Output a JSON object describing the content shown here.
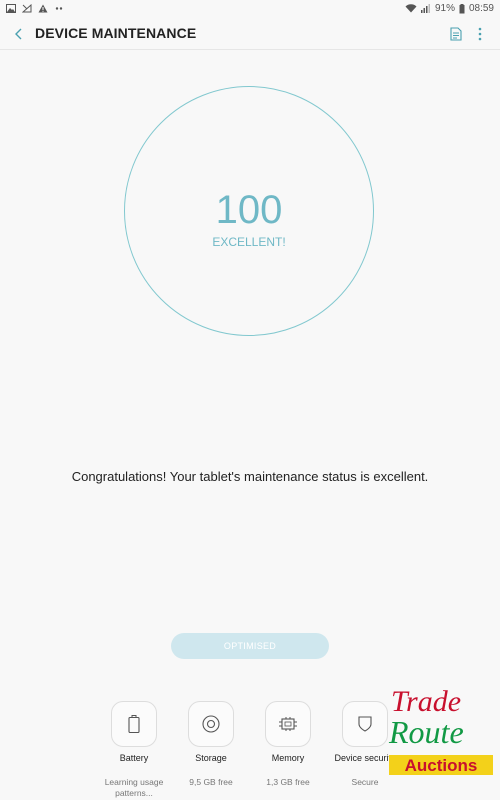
{
  "status_bar": {
    "battery": "91%",
    "time": "08:59"
  },
  "toolbar": {
    "title": "DEVICE MAINTENANCE"
  },
  "score": {
    "value": "100",
    "label": "EXCELLENT!"
  },
  "message": "Congratulations! Your tablet's maintenance status is excellent.",
  "optimise_button": {
    "label": "OPTIMISED",
    "enabled": false
  },
  "items": [
    {
      "label": "Battery",
      "value": "Learning usage patterns...",
      "icon": "battery-icon"
    },
    {
      "label": "Storage",
      "value": "9,5 GB free",
      "icon": "storage-icon"
    },
    {
      "label": "Memory",
      "value": "1,3 GB free",
      "icon": "memory-chip-icon"
    },
    {
      "label": "Device security",
      "value": "Secure",
      "icon": "shield-icon"
    }
  ],
  "watermark": {
    "line1": "Trade",
    "line2": "Route",
    "line3": "Auctions"
  },
  "colors": {
    "accent": "#6fb8c6",
    "circle": "#82c8cf",
    "button": "#cfe7ee"
  }
}
